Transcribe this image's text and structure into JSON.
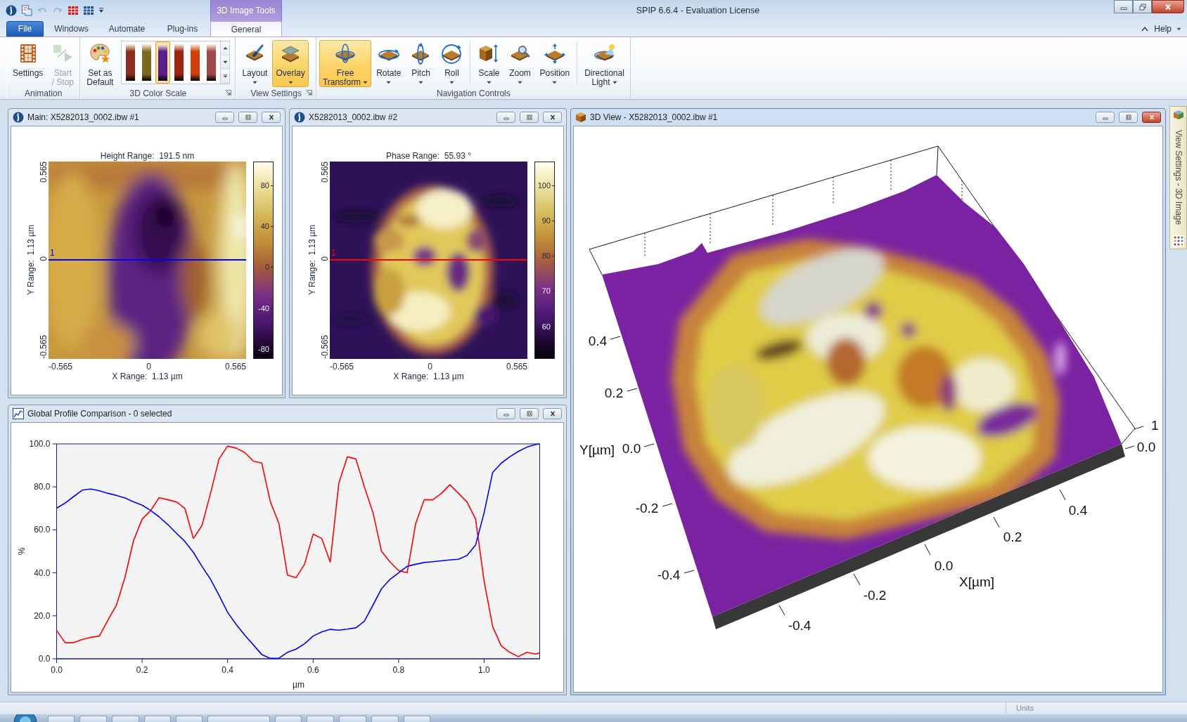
{
  "window": {
    "title": "SPIP 6.6.4 - Evaluation License"
  },
  "quick_access_toolbar": [
    {
      "disabled": false
    },
    {
      "disabled": true
    },
    {
      "disabled": true
    },
    {
      "disabled": false
    },
    {
      "disabled": false
    }
  ],
  "contextual_tab_group": {
    "label": "3D Image Tools"
  },
  "tabs": [
    {
      "label": "File",
      "kind": "file",
      "selected": false
    },
    {
      "label": "Windows",
      "kind": "tab",
      "selected": false
    },
    {
      "label": "Automate",
      "kind": "tab",
      "selected": false
    },
    {
      "label": "Plug-ins",
      "kind": "tab",
      "selected": false
    },
    {
      "label": "General",
      "kind": "contextual",
      "selected": true
    }
  ],
  "help": {
    "label": "Help"
  },
  "ribbon_groups": [
    {
      "label": "Animation",
      "launcher": false,
      "items": [
        {
          "kind": "large",
          "lines": [
            "Settings"
          ],
          "selected": false,
          "disabled": false,
          "dropdown": false
        },
        {
          "kind": "large",
          "lines": [
            "Start",
            "/ Stop"
          ],
          "selected": false,
          "disabled": true,
          "dropdown": false
        }
      ]
    },
    {
      "label": "3D Color Scale",
      "launcher": true,
      "items": [
        {
          "kind": "large",
          "lines": [
            "Set as",
            "Default"
          ],
          "selected": false,
          "disabled": false,
          "dropdown": false
        },
        {
          "kind": "gallery",
          "swatches": [
            {
              "color": "#8c2e1e",
              "selected": false
            },
            {
              "color": "#7c6a1c",
              "selected": false
            },
            {
              "color": "#5c1c8c",
              "selected": true
            },
            {
              "color": "#9c2410",
              "selected": false
            },
            {
              "color": "#d0400c",
              "selected": false
            },
            {
              "color": "#a04848",
              "selected": false
            }
          ]
        }
      ]
    },
    {
      "label": "View Settings",
      "launcher": true,
      "items": [
        {
          "kind": "large",
          "lines": [
            "Layout"
          ],
          "selected": false,
          "disabled": false,
          "dropdown": true
        },
        {
          "kind": "large",
          "lines": [
            "Overlay"
          ],
          "selected": true,
          "disabled": false,
          "dropdown": true
        }
      ]
    },
    {
      "label": "Navigation Controls",
      "launcher": false,
      "items": [
        {
          "kind": "large",
          "lines": [
            "Free",
            "Transform"
          ],
          "selected": true,
          "disabled": false,
          "dropdown": true
        },
        {
          "kind": "large",
          "lines": [
            "Rotate"
          ],
          "selected": false,
          "disabled": false,
          "dropdown": true
        },
        {
          "kind": "large",
          "lines": [
            "Pitch"
          ],
          "selected": false,
          "disabled": false,
          "dropdown": true
        },
        {
          "kind": "large",
          "lines": [
            "Roll"
          ],
          "selected": false,
          "disabled": false,
          "dropdown": true
        },
        {
          "kind": "separator"
        },
        {
          "kind": "large",
          "lines": [
            "Scale"
          ],
          "selected": false,
          "disabled": false,
          "dropdown": true
        },
        {
          "kind": "large",
          "lines": [
            "Zoom"
          ],
          "selected": false,
          "disabled": false,
          "dropdown": true
        },
        {
          "kind": "large",
          "lines": [
            "Position"
          ],
          "selected": false,
          "disabled": false,
          "dropdown": true
        },
        {
          "kind": "separator"
        },
        {
          "kind": "large",
          "lines": [
            "Directional",
            "Light"
          ],
          "selected": false,
          "disabled": false,
          "dropdown": true
        }
      ]
    }
  ],
  "windows": [
    {
      "kind": "image",
      "title": "Main: X5282013_0002.ibw #1",
      "active": false,
      "image_title": "Height Range:  191.5 nm",
      "y_label": "Y Range:  1.13 µm",
      "y_ticks": [
        "0.565",
        "0",
        "-0.565"
      ],
      "x_ticks": [
        "-0.565",
        "0",
        "0.565"
      ],
      "x_label": "X Range:  1.13 µm",
      "colorbar_ticks": [
        "80",
        "40",
        "0",
        "-40",
        "-80"
      ],
      "profile_line": {
        "label": "1",
        "color": "#0000ff"
      }
    },
    {
      "kind": "image",
      "title": "X5282013_0002.ibw #2",
      "active": false,
      "image_title": "Phase Range:  55.93 °",
      "y_label": "Y Range:  1.13 µm",
      "y_ticks": [
        "0.565",
        "0",
        "-0.565"
      ],
      "x_ticks": [
        "-0.565",
        "0",
        "0.565"
      ],
      "x_label": "X Range:  1.13 µm",
      "colorbar_ticks": [
        "100",
        "90",
        "80",
        "70",
        "60"
      ],
      "profile_line": {
        "label": "1",
        "color": "#ff0000"
      }
    },
    {
      "kind": "profile",
      "title": "Global Profile Comparison - 0 selected",
      "active": false,
      "chart_data": {
        "type": "line",
        "xlabel": "µm",
        "ylabel": "%",
        "x": [
          0,
          0.02,
          0.04,
          0.06,
          0.08,
          0.1,
          0.12,
          0.14,
          0.16,
          0.18,
          0.2,
          0.22,
          0.24,
          0.26,
          0.28,
          0.3,
          0.32,
          0.34,
          0.36,
          0.38,
          0.4,
          0.42,
          0.44,
          0.46,
          0.48,
          0.5,
          0.52,
          0.54,
          0.56,
          0.58,
          0.6,
          0.62,
          0.64,
          0.66,
          0.68,
          0.7,
          0.72,
          0.74,
          0.76,
          0.78,
          0.8,
          0.82,
          0.84,
          0.86,
          0.88,
          0.9,
          0.92,
          0.94,
          0.96,
          0.98,
          1,
          1.02,
          1.04,
          1.06,
          1.08,
          1.1,
          1.12,
          1.13
        ],
        "series": [
          {
            "color": "#ff0000",
            "values": [
              13.2,
              7.5,
              7.5,
              9,
              10,
              10.6,
              18,
              25,
              38,
              55,
              65,
              69,
              75,
              74,
              73,
              70,
              56,
              62,
              77,
              93,
              99,
              98,
              96,
              92,
              91,
              73,
              63,
              39,
              37.7,
              44,
              58,
              56,
              45,
              81.6,
              94,
              93,
              80,
              68,
              50,
              45,
              41,
              40,
              63,
              74,
              74,
              77,
              81,
              77,
              73,
              65,
              36,
              15,
              6,
              3,
              1,
              3,
              2.2,
              2.7
            ]
          },
          {
            "color": "#0000ff",
            "values": [
              70.1,
              72.5,
              75.5,
              78.5,
              79,
              78.2,
              77,
              76,
              74.8,
              73,
              71.5,
              69,
              66,
              62.5,
              58.5,
              54.6,
              49.5,
              43,
              37,
              29.5,
              21.6,
              16,
              11,
              6.5,
              2,
              0.2,
              0.3,
              3,
              4.5,
              7,
              10.6,
              12.5,
              13.7,
              13.3,
              13.8,
              14.4,
              17.5,
              25,
              32.6,
              37,
              40,
              43,
              44,
              44.8,
              45.2,
              45.6,
              46,
              46.3,
              48,
              52.9,
              68,
              86.7,
              91,
              94,
              96.5,
              98.5,
              99.7,
              100
            ]
          }
        ],
        "xlim": [
          0,
          1.13
        ],
        "ylim": [
          0,
          100
        ],
        "xticks": [
          {
            "value": 0,
            "label": "0.0"
          },
          {
            "value": 0.2,
            "label": "0.2"
          },
          {
            "value": 0.4,
            "label": "0.4"
          },
          {
            "value": 0.6,
            "label": "0.6"
          },
          {
            "value": 0.8,
            "label": "0.8"
          },
          {
            "value": 1,
            "label": "1.0"
          }
        ],
        "yticks": [
          {
            "value": 0,
            "label": "0.0"
          },
          {
            "value": 20,
            "label": "20.0"
          },
          {
            "value": 40,
            "label": "40.0"
          },
          {
            "value": 60,
            "label": "60.0"
          },
          {
            "value": 80,
            "label": "80.0"
          },
          {
            "value": 100,
            "label": "100.0"
          }
        ]
      }
    },
    {
      "kind": "surface3d",
      "title": "3D View - X5282013_0002.ibw #1",
      "active": true,
      "y_label": "Y[µm]",
      "y_ticks": [
        "0.4",
        "0.2",
        "0.0",
        "-0.2",
        "-0.4"
      ],
      "x_label": "X[µm]",
      "x_ticks": [
        "-0.4",
        "-0.2",
        "0.0",
        "0.2",
        "0.4"
      ],
      "z_ticks": [
        "1",
        "0.0"
      ]
    }
  ],
  "side_tab": {
    "label": "View Settings - 3D Image"
  },
  "status_bar": {
    "units_label": "Units"
  }
}
